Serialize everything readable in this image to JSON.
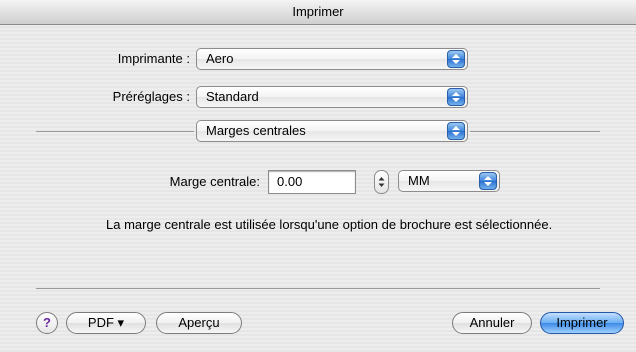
{
  "window": {
    "title": "Imprimer"
  },
  "printer": {
    "label": "Imprimante :",
    "value": "Aero"
  },
  "presets": {
    "label": "Préréglages :",
    "value": "Standard"
  },
  "panel": {
    "value": "Marges centrales"
  },
  "margin": {
    "label": "Marge centrale:",
    "value": "0.00",
    "unit": "MM",
    "description": "La marge centrale est utilisée lorsqu'une option de brochure est sélectionnée."
  },
  "footer": {
    "help": "?",
    "pdf": "PDF ▾",
    "preview": "Aperçu",
    "cancel": "Annuler",
    "print": "Imprimer"
  },
  "colors": {
    "accent": "#3c8ae6",
    "help_glyph": "#6a2aa0"
  }
}
